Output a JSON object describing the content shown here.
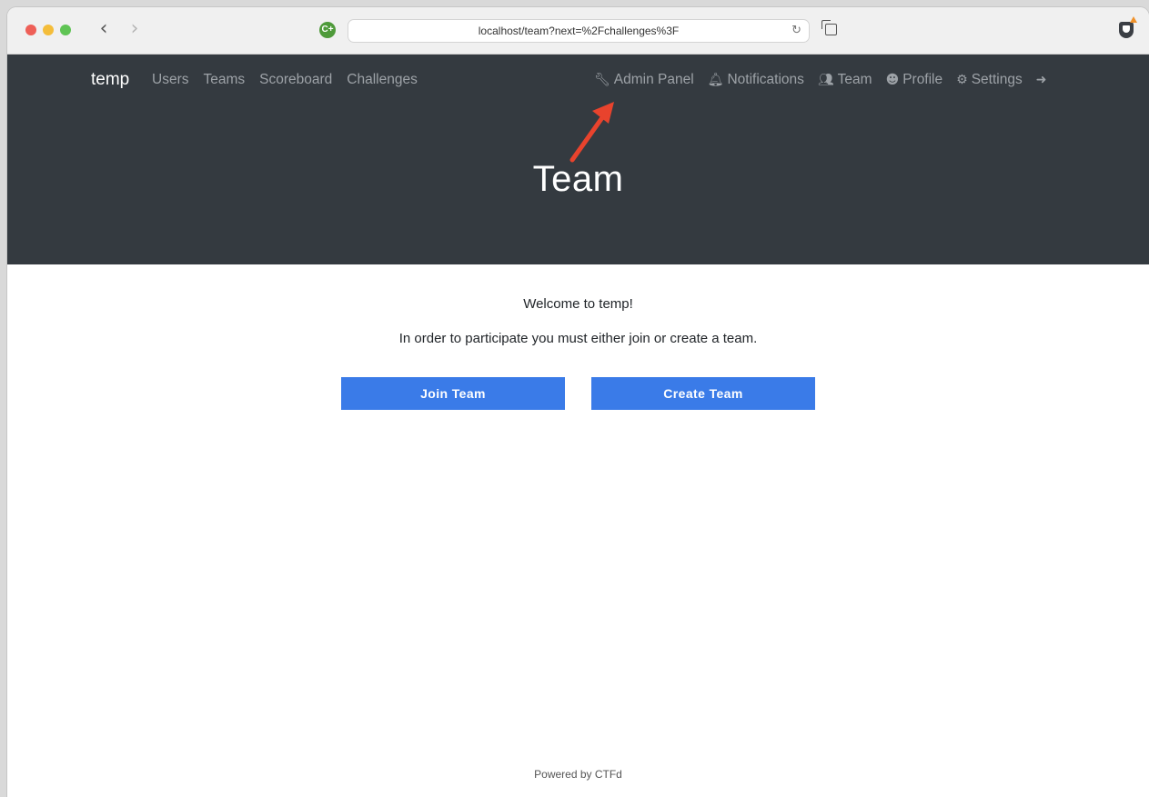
{
  "browser": {
    "url": "localhost/team?next=%2Fchallenges%3F",
    "ext_label": "C+"
  },
  "nav": {
    "brand": "temp",
    "left": [
      "Users",
      "Teams",
      "Scoreboard",
      "Challenges"
    ],
    "right": [
      {
        "icon": "wrench-icon",
        "label": "Admin Panel"
      },
      {
        "icon": "bell-icon",
        "label": "Notifications"
      },
      {
        "icon": "users-icon",
        "label": "Team"
      },
      {
        "icon": "user-circle-icon",
        "label": "Profile"
      },
      {
        "icon": "cogs-icon",
        "label": "Settings"
      }
    ],
    "logout_icon": "sign-out-icon"
  },
  "hero": {
    "title": "Team"
  },
  "content": {
    "welcome": "Welcome to temp!",
    "instruction": "In order to participate you must either join or create a team.",
    "join_label": "Join Team",
    "create_label": "Create Team"
  },
  "footer": {
    "text": "Powered by CTFd"
  },
  "colors": {
    "header_bg": "#343a40",
    "button_bg": "#3a7be8",
    "annotation_arrow": "#e8432d"
  }
}
